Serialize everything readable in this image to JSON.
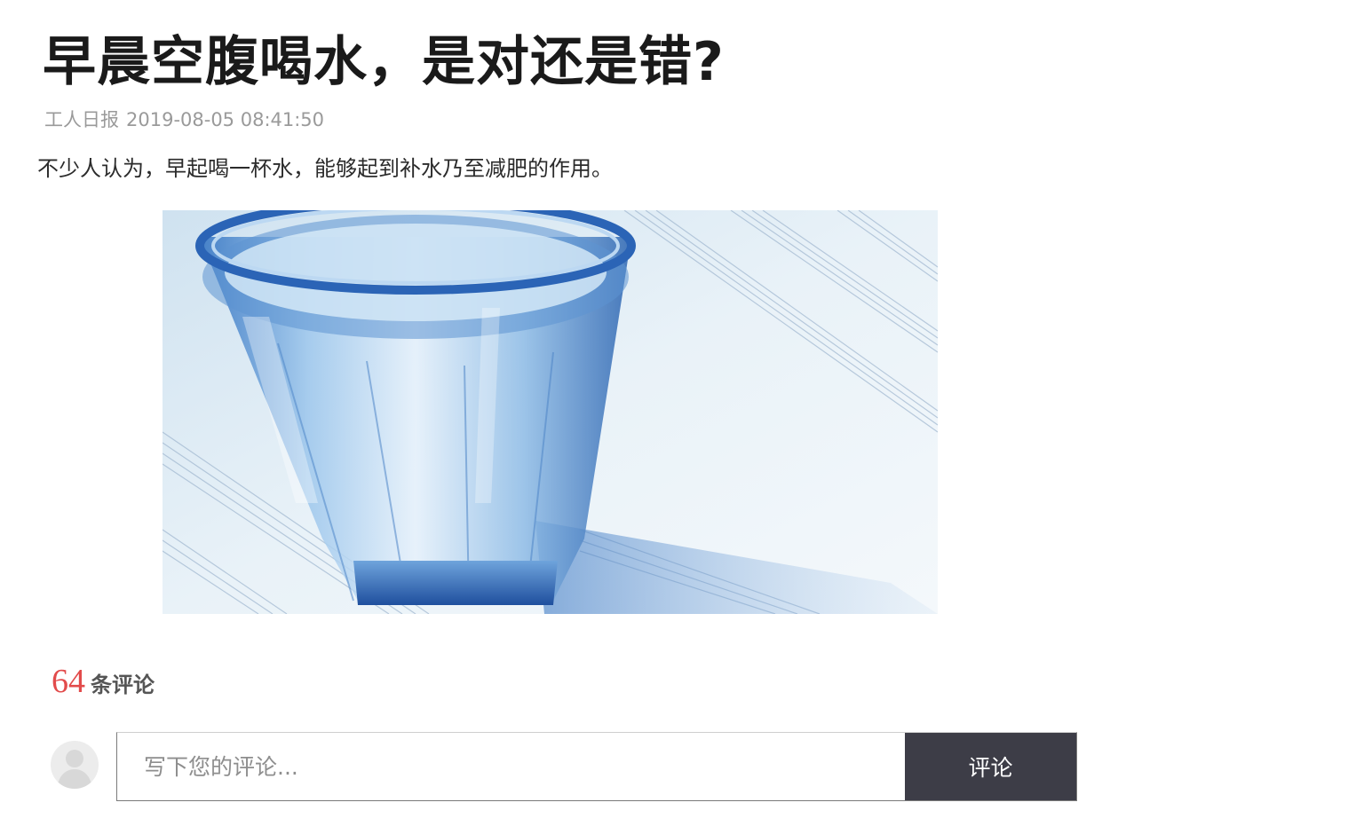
{
  "article": {
    "title": "早晨空腹喝水，是对还是错?",
    "source": "工人日报",
    "datetime": "2019-08-05 08:41:50",
    "lead": "不少人认为，早起喝一杯水，能够起到补水乃至减肥的作用。"
  },
  "comments": {
    "count": "64",
    "count_label": "条评论",
    "input_placeholder": "写下您的评论...",
    "submit_label": "评论"
  },
  "colors": {
    "count_red": "#e24b4b",
    "submit_bg": "#3d3d47"
  },
  "icons": {
    "avatar": "user-avatar-placeholder-icon"
  }
}
